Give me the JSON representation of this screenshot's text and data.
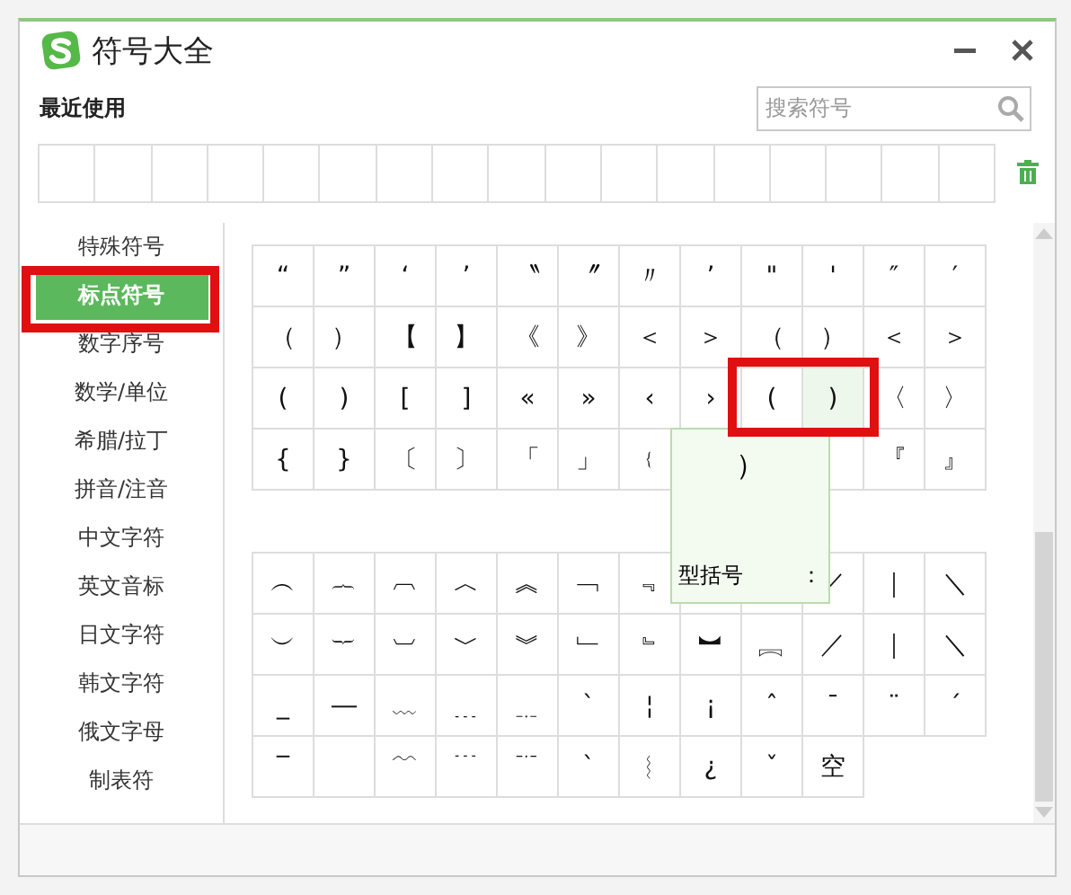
{
  "window": {
    "title": "符号大全"
  },
  "recent": {
    "label": "最近使用"
  },
  "search": {
    "placeholder": "搜索符号"
  },
  "sidebar": {
    "items": [
      {
        "label": "特殊符号",
        "selected": false,
        "highlighted": false
      },
      {
        "label": "标点符号",
        "selected": true,
        "highlighted": true
      },
      {
        "label": "数字序号",
        "selected": false,
        "highlighted": false
      },
      {
        "label": "数学/单位",
        "selected": false,
        "highlighted": false
      },
      {
        "label": "希腊/拉丁",
        "selected": false,
        "highlighted": false
      },
      {
        "label": "拼音/注音",
        "selected": false,
        "highlighted": false
      },
      {
        "label": "中文字符",
        "selected": false,
        "highlighted": false
      },
      {
        "label": "英文音标",
        "selected": false,
        "highlighted": false
      },
      {
        "label": "日文字符",
        "selected": false,
        "highlighted": false
      },
      {
        "label": "韩文字符",
        "selected": false,
        "highlighted": false
      },
      {
        "label": "俄文字母",
        "selected": false,
        "highlighted": false
      },
      {
        "label": "制表符",
        "selected": false,
        "highlighted": false
      }
    ]
  },
  "grids": [
    {
      "rows": [
        [
          "“",
          "”",
          "‘",
          "’",
          "〝",
          "〞",
          "〃",
          "’",
          "\"",
          "'",
          "″",
          "′"
        ],
        [
          "（",
          "）",
          "【",
          "】",
          "《",
          "》",
          "＜",
          "＞",
          "（",
          "）",
          "＜",
          "＞"
        ],
        [
          "(",
          ")",
          "[",
          "]",
          "«",
          "»",
          "‹",
          "›",
          {
            "symbol": "(",
            "highlighted": true,
            "hovered": false
          },
          {
            "symbol": ")",
            "highlighted": true,
            "hovered": true
          },
          "〈",
          "〉"
        ],
        [
          "{",
          "}",
          "〔",
          "〕",
          "「",
          "」",
          "﹛",
          null,
          null,
          null,
          "『",
          "』"
        ]
      ]
    },
    {
      "rows": [
        [
          "︵",
          "︷",
          "︹",
          "︿",
          "︽",
          "﹁",
          "﹃",
          null,
          null,
          "／",
          "｜",
          "＼"
        ],
        [
          "︶",
          "︸",
          "︺",
          "﹀",
          "︾",
          "﹂",
          "﹄",
          "︼",
          "︘",
          "／",
          "｜",
          "＼"
        ],
        [
          "_",
          "―",
          "﹏",
          "﹍",
          "﹎",
          "ˋ",
          "¦",
          "¡",
          "ˆ",
          "ˉ",
          "¨",
          "ˊ"
        ],
        [
          "‾",
          null,
          "﹋",
          "﹉",
          "﹊",
          "ˋ",
          "︴",
          "¿",
          "ˇ",
          "空"
        ]
      ]
    }
  ],
  "tooltip": {
    "preview": "）",
    "label": "型括号",
    "colon": "："
  }
}
